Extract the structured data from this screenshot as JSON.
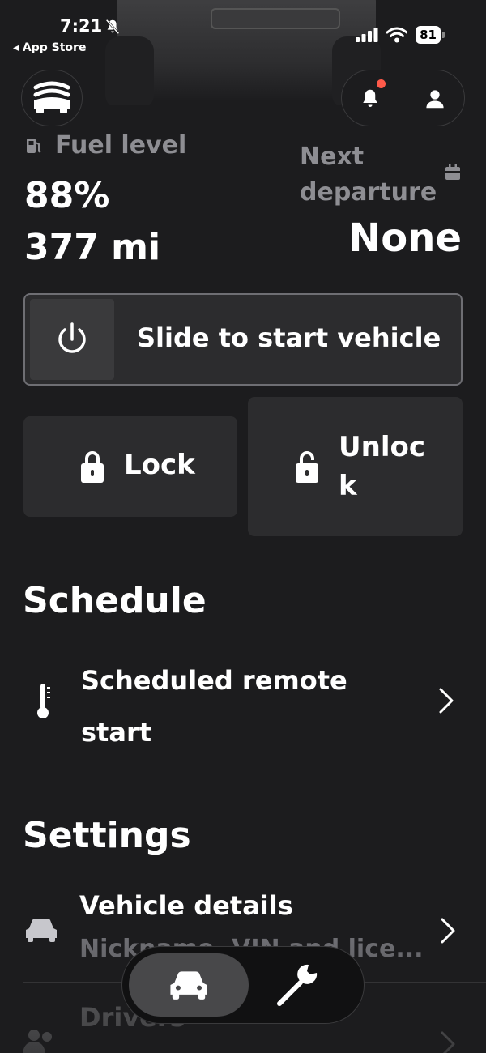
{
  "status_bar": {
    "time": "7:21",
    "back_label": "◂ App Store",
    "battery": "81"
  },
  "header": {
    "logo_icon": "vehicle-front-logo-icon",
    "notification_icon": "bell-icon",
    "notification_dot_color": "#ff5a4a",
    "profile_icon": "person-icon"
  },
  "fuel": {
    "label": "Fuel level",
    "percent": "88%",
    "range": "377 mi"
  },
  "departure": {
    "label": "Next departure",
    "value": "None"
  },
  "slider": {
    "label": "Slide to start vehicle",
    "icon": "power-icon"
  },
  "actions": {
    "lock_label": "Lock",
    "unlock_label": "Unlock"
  },
  "schedule": {
    "title": "Schedule",
    "items": [
      {
        "label": "Scheduled remote start",
        "icon": "thermometer-icon"
      }
    ]
  },
  "settings": {
    "title": "Settings",
    "items": [
      {
        "label": "Vehicle details",
        "sublabel": "Nickname, VIN and lice...",
        "icon": "car-icon"
      },
      {
        "label": "Drivers",
        "icon": "people-icon"
      }
    ]
  },
  "bottom_nav": {
    "items": [
      {
        "icon": "car-icon",
        "active": true
      },
      {
        "icon": "wrench-icon",
        "active": false
      }
    ]
  },
  "colors": {
    "background": "#1c1c1e",
    "card": "#2c2c2e",
    "muted_text": "#8e8e93"
  }
}
